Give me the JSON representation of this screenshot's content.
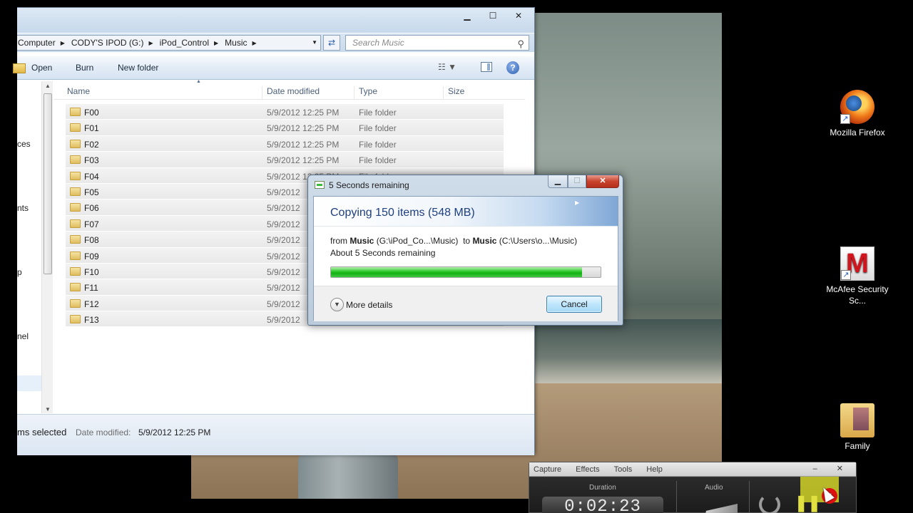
{
  "explorer": {
    "breadcrumb": [
      "Computer",
      "CODY'S IPOD (G:)",
      "iPod_Control",
      "Music"
    ],
    "search_placeholder": "Search Music",
    "window_controls": {
      "minimize": "▁",
      "maximize": "☐",
      "close": "✕"
    },
    "toolbar": {
      "open": "Open",
      "burn": "Burn",
      "new_folder": "New folder"
    },
    "nav_fragments": [
      "ces",
      "nts",
      "p",
      "nel"
    ],
    "columns": {
      "name": "Name",
      "date": "Date modified",
      "type": "Type",
      "size": "Size"
    },
    "rows": [
      {
        "name": "F00",
        "date": "5/9/2012 12:25 PM",
        "type": "File folder"
      },
      {
        "name": "F01",
        "date": "5/9/2012 12:25 PM",
        "type": "File folder"
      },
      {
        "name": "F02",
        "date": "5/9/2012 12:25 PM",
        "type": "File folder"
      },
      {
        "name": "F03",
        "date": "5/9/2012 12:25 PM",
        "type": "File folder"
      },
      {
        "name": "F04",
        "date": "5/9/2012 12:25 PM",
        "type": "File folder"
      },
      {
        "name": "F05",
        "date": "5/9/2012",
        "type": ""
      },
      {
        "name": "F06",
        "date": "5/9/2012",
        "type": ""
      },
      {
        "name": "F07",
        "date": "5/9/2012",
        "type": ""
      },
      {
        "name": "F08",
        "date": "5/9/2012",
        "type": ""
      },
      {
        "name": "F09",
        "date": "5/9/2012",
        "type": ""
      },
      {
        "name": "F10",
        "date": "5/9/2012",
        "type": ""
      },
      {
        "name": "F11",
        "date": "5/9/2012",
        "type": ""
      },
      {
        "name": "F12",
        "date": "5/9/2012",
        "type": ""
      },
      {
        "name": "F13",
        "date": "5/9/2012",
        "type": ""
      }
    ],
    "status": {
      "selected": "ms selected",
      "date_label": "Date modified:",
      "date_value": "5/9/2012 12:25 PM"
    }
  },
  "dialog": {
    "title": "5 Seconds remaining",
    "heading": "Copying 150 items (548 MB)",
    "from_label": "from",
    "from_name": "Music",
    "from_path": "(G:\\iPod_Co...\\Music)",
    "to_label": "to",
    "to_name": "Music",
    "to_path": "(C:\\Users\\o...\\Music)",
    "remaining": "About 5 Seconds remaining",
    "progress": 0.93,
    "more_details": "More details",
    "cancel": "Cancel",
    "controls": {
      "minimize": "▁",
      "maximize": "☐",
      "close": "✕"
    }
  },
  "desktop_icons": [
    {
      "label": "Mozilla Firefox",
      "icon": "firefox-icon"
    },
    {
      "label": "McAfee Security Sc...",
      "icon": "mcafee-icon"
    },
    {
      "label": "Family",
      "icon": "folder-icon"
    }
  ],
  "recorder": {
    "menu": [
      "Capture",
      "Effects",
      "Tools",
      "Help"
    ],
    "duration_label": "Duration",
    "audio_label": "Audio",
    "time": "0:02:23",
    "window_controls": "– ✕"
  },
  "colors": {
    "accent": "#1e3f80",
    "progress": "#14b014",
    "close": "#c8422c"
  }
}
